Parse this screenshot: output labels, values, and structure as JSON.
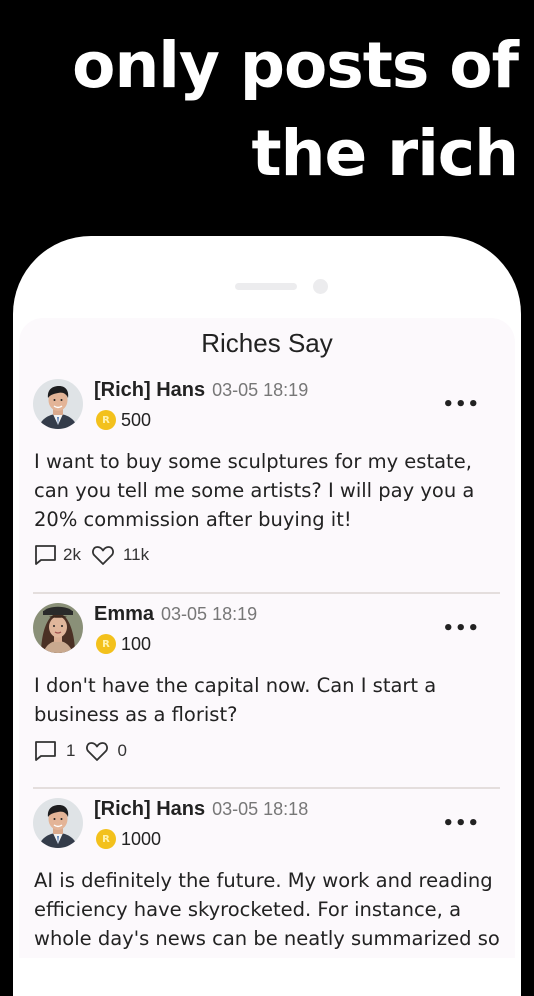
{
  "headline": {
    "line1": "only posts of",
    "line2": "the rich"
  },
  "app": {
    "title": "Riches Say"
  },
  "coin_icon": "R",
  "posts": [
    {
      "name": "[Rich] Hans",
      "time": "03-05 18:19",
      "coins": "500",
      "text": "I want to buy some sculptures for my estate, can you tell me some artists? I will pay you a 20% commission after buying it!",
      "comments": "2k",
      "likes": "11k"
    },
    {
      "name": "Emma",
      "time": "03-05 18:19",
      "coins": "100",
      "text": "I don't have the capital now. Can I start a business as a florist?",
      "comments": "1",
      "likes": "0"
    },
    {
      "name": "[Rich] Hans",
      "time": "03-05 18:18",
      "coins": "1000",
      "text": "AI is definitely the future. My work and reading efficiency have skyrocketed. For instance, a whole day's news can be neatly summarized so",
      "comments": "",
      "likes": ""
    }
  ],
  "colors": {
    "background": "#000000",
    "screen": "#fcf9fc",
    "coin": "#f3c11c",
    "divider": "#e4dedd"
  }
}
